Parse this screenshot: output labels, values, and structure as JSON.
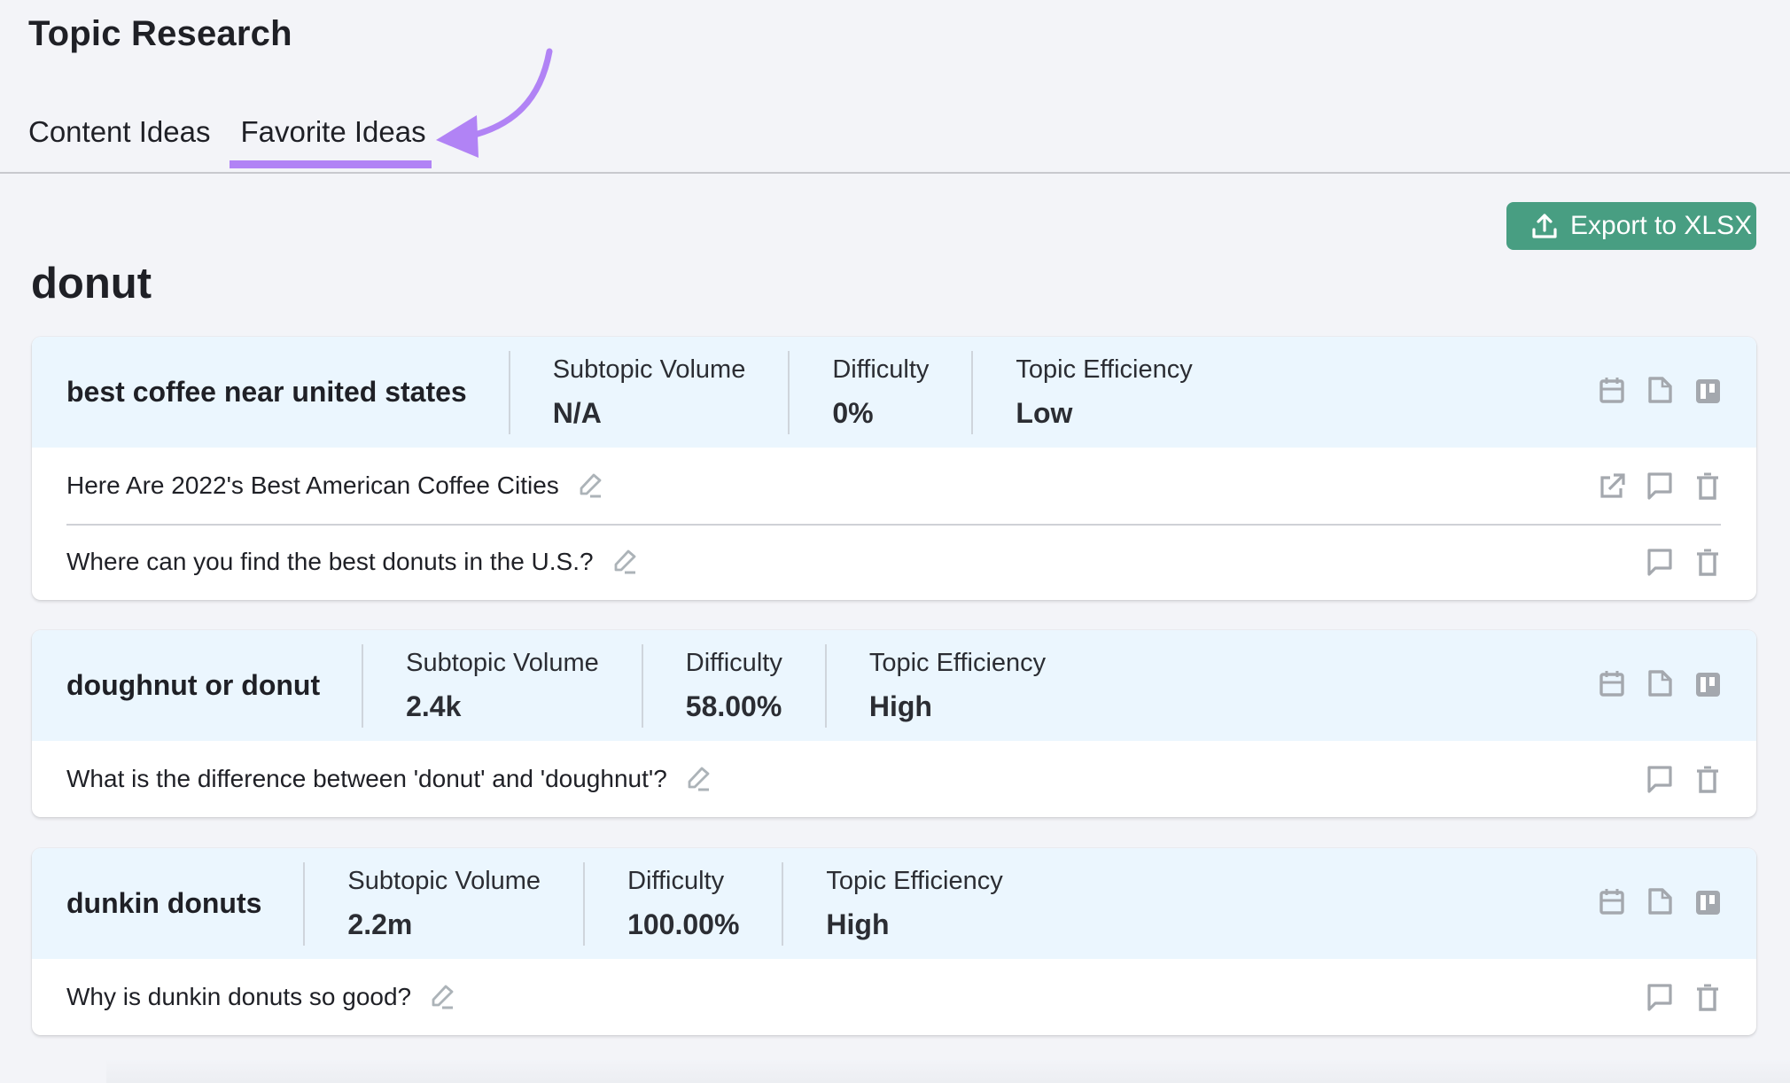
{
  "header": {
    "title": "Topic Research",
    "tabs": [
      {
        "label": "Content Ideas",
        "active": false
      },
      {
        "label": "Favorite Ideas",
        "active": true
      }
    ],
    "annotation_color": "#b183f5"
  },
  "toolbar": {
    "export_label": "Export to XLSX",
    "export_icon": "upload-icon",
    "export_color": "#489e82"
  },
  "group": {
    "title": "donut",
    "cards": [
      {
        "topic": "best coffee near united states",
        "metrics": [
          {
            "label": "Subtopic Volume",
            "value": "N/A"
          },
          {
            "label": "Difficulty",
            "value": "0%"
          },
          {
            "label": "Topic Efficiency",
            "value": "Low"
          }
        ],
        "header_icons": [
          "calendar-icon",
          "document-icon",
          "trello-board-icon"
        ],
        "ideas": [
          {
            "text": "Here Are 2022's Best American Coffee Cities",
            "icons": [
              "external-link-icon",
              "comment-icon",
              "trash-icon"
            ]
          },
          {
            "text": "Where can you find the best donuts in the U.S.?",
            "icons": [
              "comment-icon",
              "trash-icon"
            ]
          }
        ]
      },
      {
        "topic": "doughnut or donut",
        "metrics": [
          {
            "label": "Subtopic Volume",
            "value": "2.4k"
          },
          {
            "label": "Difficulty",
            "value": "58.00%"
          },
          {
            "label": "Topic Efficiency",
            "value": "High"
          }
        ],
        "header_icons": [
          "calendar-icon",
          "document-icon",
          "trello-board-icon"
        ],
        "ideas": [
          {
            "text": "What is the difference between 'donut' and 'doughnut'?",
            "icons": [
              "comment-icon",
              "trash-icon"
            ]
          }
        ]
      },
      {
        "topic": "dunkin donuts",
        "metrics": [
          {
            "label": "Subtopic Volume",
            "value": "2.2m"
          },
          {
            "label": "Difficulty",
            "value": "100.00%"
          },
          {
            "label": "Topic Efficiency",
            "value": "High"
          }
        ],
        "header_icons": [
          "calendar-icon",
          "document-icon",
          "trello-board-icon"
        ],
        "ideas": [
          {
            "text": "Why is dunkin donuts so good?",
            "icons": [
              "comment-icon",
              "trash-icon"
            ]
          }
        ]
      }
    ]
  }
}
